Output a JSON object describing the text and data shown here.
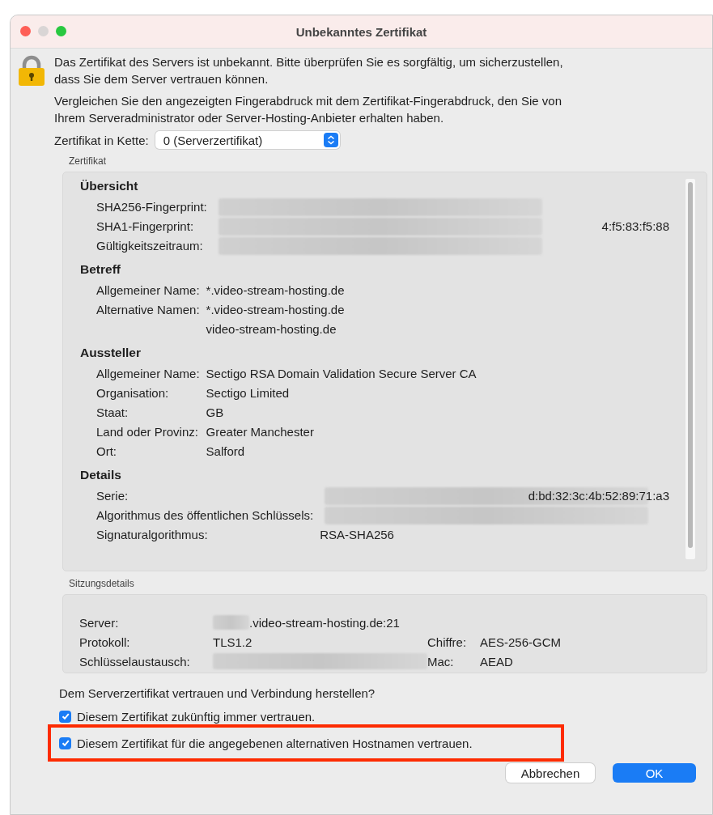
{
  "window": {
    "title": "Unbekanntes Zertifikat"
  },
  "intro": [
    "Das Zertifikat des Servers ist unbekannt. Bitte überprüfen Sie es sorgfältig, um sicherzustellen, dass Sie dem Server vertrauen können.",
    "Vergleichen Sie den angezeigten Fingerabdruck mit dem Zertifikat-Fingerabdruck, den Sie von Ihrem Serveradministrator oder Server-Hosting-Anbieter erhalten haben."
  ],
  "chain": {
    "label": "Zertifikat in Kette:",
    "value": "0 (Serverzertifikat)"
  },
  "certificate": {
    "title": "Zertifikat",
    "sections": [
      {
        "heading": "Übersicht",
        "rows": [
          {
            "label": "SHA256-Fingerprint:",
            "values": [],
            "redacted": true
          },
          {
            "label": "SHA1-Fingerprint:",
            "values": [
              "4:f5:83:f5:88"
            ],
            "redacted": true
          },
          {
            "label": "Gültigkeitszeitraum:",
            "values": [],
            "redacted": true
          }
        ]
      },
      {
        "heading": "Betreff",
        "rows": [
          {
            "label": "Allgemeiner Name:",
            "values": [
              "*.video-stream-hosting.de"
            ]
          },
          {
            "label": "Alternative Namen:",
            "values": [
              "*.video-stream-hosting.de",
              "video-stream-hosting.de"
            ]
          }
        ]
      },
      {
        "heading": "Aussteller",
        "rows": [
          {
            "label": "Allgemeiner Name:",
            "values": [
              "Sectigo RSA Domain Validation Secure Server CA"
            ]
          },
          {
            "label": "Organisation:",
            "values": [
              "Sectigo Limited"
            ]
          },
          {
            "label": "Staat:",
            "values": [
              "GB"
            ]
          },
          {
            "label": "Land oder Provinz:",
            "values": [
              "Greater Manchester"
            ]
          },
          {
            "label": "Ort:",
            "values": [
              "Salford"
            ]
          }
        ]
      },
      {
        "heading": "Details",
        "rows": [
          {
            "label": "Serie:",
            "values": [
              "d:bd:32:3c:4b:52:89:71:a3"
            ],
            "redacted": true
          },
          {
            "label": "Algorithmus des öffentlichen Schlüssels:",
            "values": [],
            "redacted": true
          },
          {
            "label": "Signaturalgorithmus:",
            "values": [
              "RSA-SHA256"
            ]
          }
        ]
      }
    ]
  },
  "session": {
    "title": "Sitzungsdetails",
    "server": {
      "label": "Server:",
      "value": ".video-stream-hosting.de:21",
      "redacted": true
    },
    "left": [
      {
        "label": "Protokoll:",
        "value": "TLS1.2"
      },
      {
        "label": "Schlüsselaustausch:",
        "redacted": true
      }
    ],
    "right": [
      {
        "label": "Chiffre:",
        "value": "AES-256-GCM"
      },
      {
        "label": "Mac:",
        "value": "AEAD"
      }
    ]
  },
  "question": "Dem Serverzertifikat vertrauen und Verbindung herstellen?",
  "options": [
    {
      "label": "Diesem Zertifikat zukünftig immer vertrauen.",
      "checked": true,
      "highlighted": false
    },
    {
      "label": "Diesem Zertifikat für die angegebenen alternativen Hostnamen vertrauen.",
      "checked": true,
      "highlighted": true
    }
  ],
  "buttons": [
    {
      "label": "Abbrechen",
      "kind": "secondary"
    },
    {
      "label": "OK",
      "kind": "primary"
    }
  ]
}
